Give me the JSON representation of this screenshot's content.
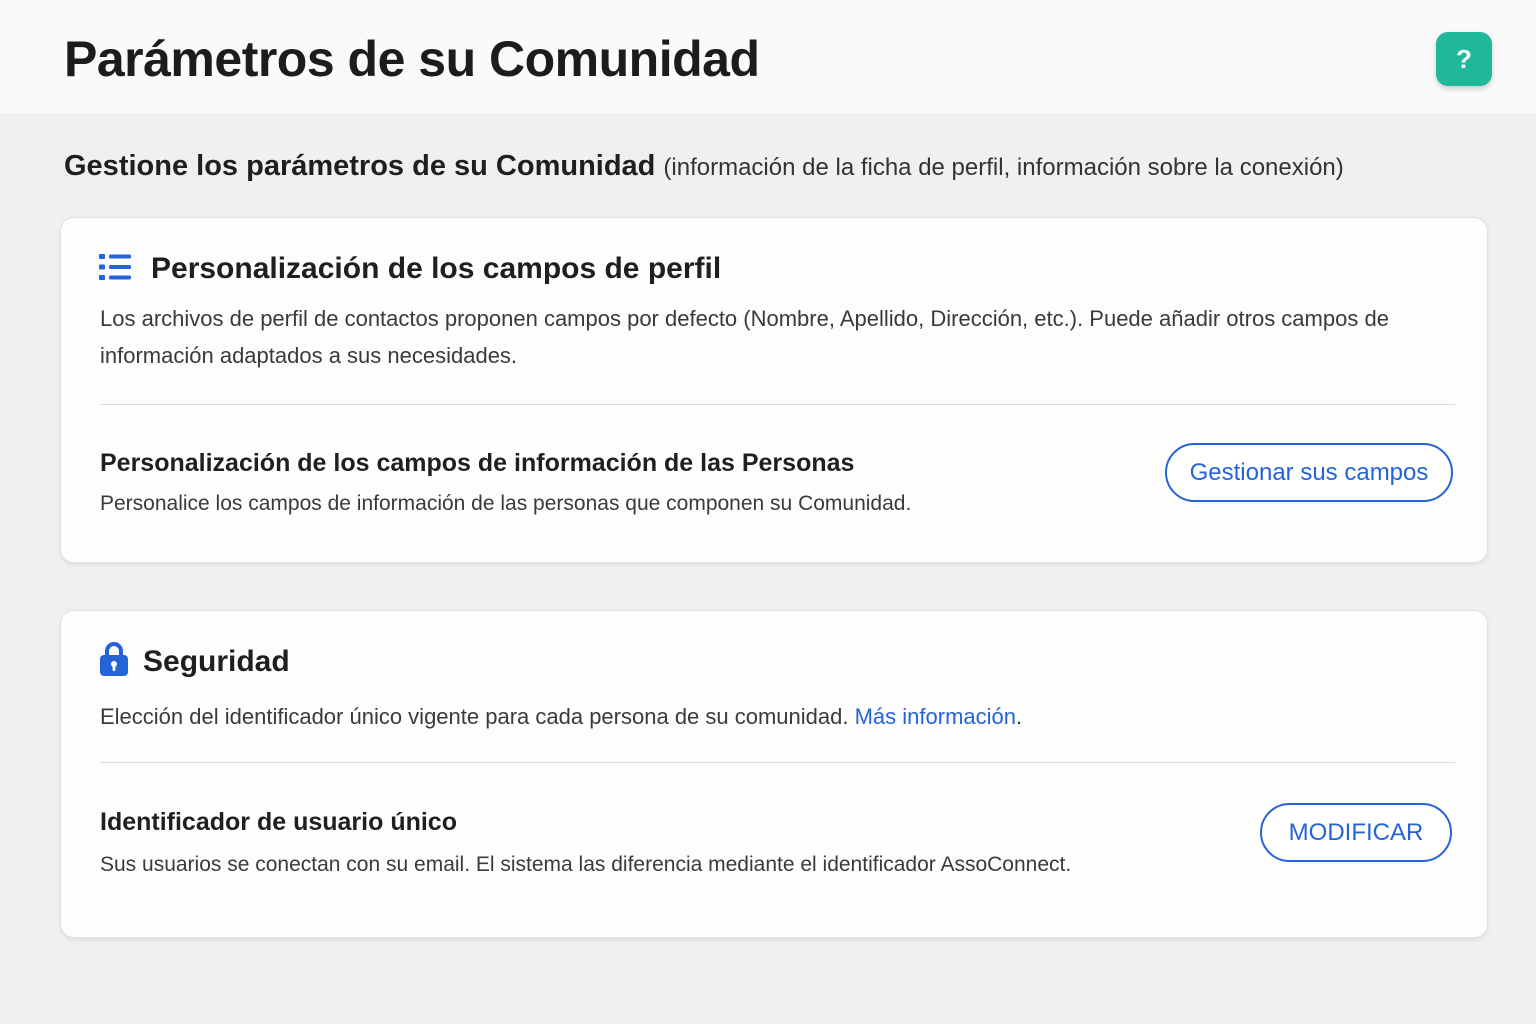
{
  "header": {
    "title": "Parámetros de su Comunidad",
    "help_label": "?"
  },
  "intro": {
    "strong": "Gestione los parámetros de su Comunidad",
    "light": "(información de la ficha de perfil, información sobre la conexión)"
  },
  "colors": {
    "accent": "#2563d8",
    "help_button": "#1fb89a",
    "background": "#f0f0f0"
  },
  "profile_card": {
    "icon": "list-icon",
    "title": "Personalización de los campos de perfil",
    "description": "Los archivos de perfil de contactos proponen campos por defecto (Nombre, Apellido, Dirección, etc.). Puede añadir otros campos de información adaptados a sus necesidades.",
    "row": {
      "title": "Personalización de los campos de información de las Personas",
      "description": "Personalice los campos de información de las personas que componen su Comunidad.",
      "button_label": "Gestionar sus campos"
    }
  },
  "security_card": {
    "icon": "lock-icon",
    "title": "Seguridad",
    "description": "Elección del identificador único vigente para cada persona de su comunidad.",
    "link_label": "Más información",
    "link_suffix": ".",
    "row": {
      "title": "Identificador de usuario único",
      "description": "Sus usuarios se conectan con su email. El sistema las diferencia mediante el identificador AssoConnect.",
      "button_label": "MODIFICAR"
    }
  }
}
